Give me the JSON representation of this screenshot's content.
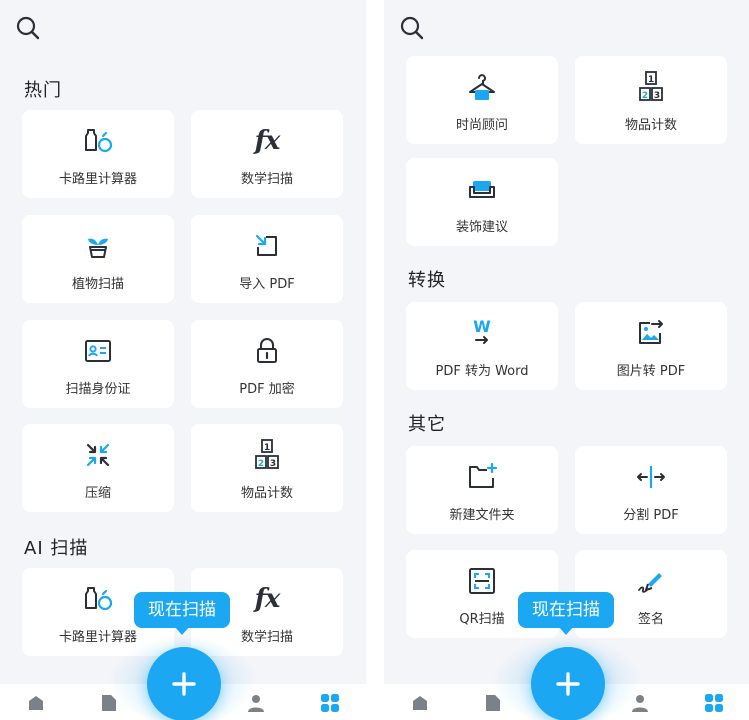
{
  "left": {
    "sections": [
      {
        "title": "热门"
      },
      {
        "title": "AI 扫描"
      }
    ],
    "cards": [
      {
        "label": "卡路里计算器",
        "icon": "calorie-bottle-icon"
      },
      {
        "label": "数学扫描",
        "icon": "fx-math-icon"
      },
      {
        "label": "植物扫描",
        "icon": "plant-pot-icon"
      },
      {
        "label": "导入 PDF",
        "icon": "import-arrow-icon"
      },
      {
        "label": "扫描身份证",
        "icon": "id-card-icon"
      },
      {
        "label": "PDF 加密",
        "icon": "lock-icon"
      },
      {
        "label": "压缩",
        "icon": "compress-arrows-icon"
      },
      {
        "label": "物品计数",
        "icon": "count-blocks-icon"
      },
      {
        "label": "卡路里计算器",
        "icon": "calorie-bottle-icon"
      },
      {
        "label": "数学扫描",
        "icon": "fx-math-icon"
      }
    ],
    "tooltip": "现在扫描"
  },
  "right": {
    "sections": [
      {
        "title": "转换"
      },
      {
        "title": "其它"
      }
    ],
    "cards": [
      {
        "label": "时尚顾问",
        "icon": "hanger-icon"
      },
      {
        "label": "物品计数",
        "icon": "count-blocks-icon"
      },
      {
        "label": "装饰建议",
        "icon": "sofa-icon"
      },
      {
        "label": "PDF 转为 Word",
        "icon": "word-convert-icon"
      },
      {
        "label": "图片转 PDF",
        "icon": "image-convert-icon"
      },
      {
        "label": "新建文件夹",
        "icon": "new-folder-icon"
      },
      {
        "label": "分割 PDF",
        "icon": "split-icon"
      },
      {
        "label": "QR扫描",
        "icon": "qr-frame-icon"
      },
      {
        "label": "签名",
        "icon": "pen-sign-icon"
      }
    ],
    "tooltip": "现在扫描"
  },
  "icon_glyphs": {
    "fx": "fx",
    "word": "W"
  },
  "colors": {
    "accent": "#1ba7f2",
    "icon_dark": "#2a2f38",
    "background": "#f4f5f8",
    "card": "#ffffff"
  }
}
